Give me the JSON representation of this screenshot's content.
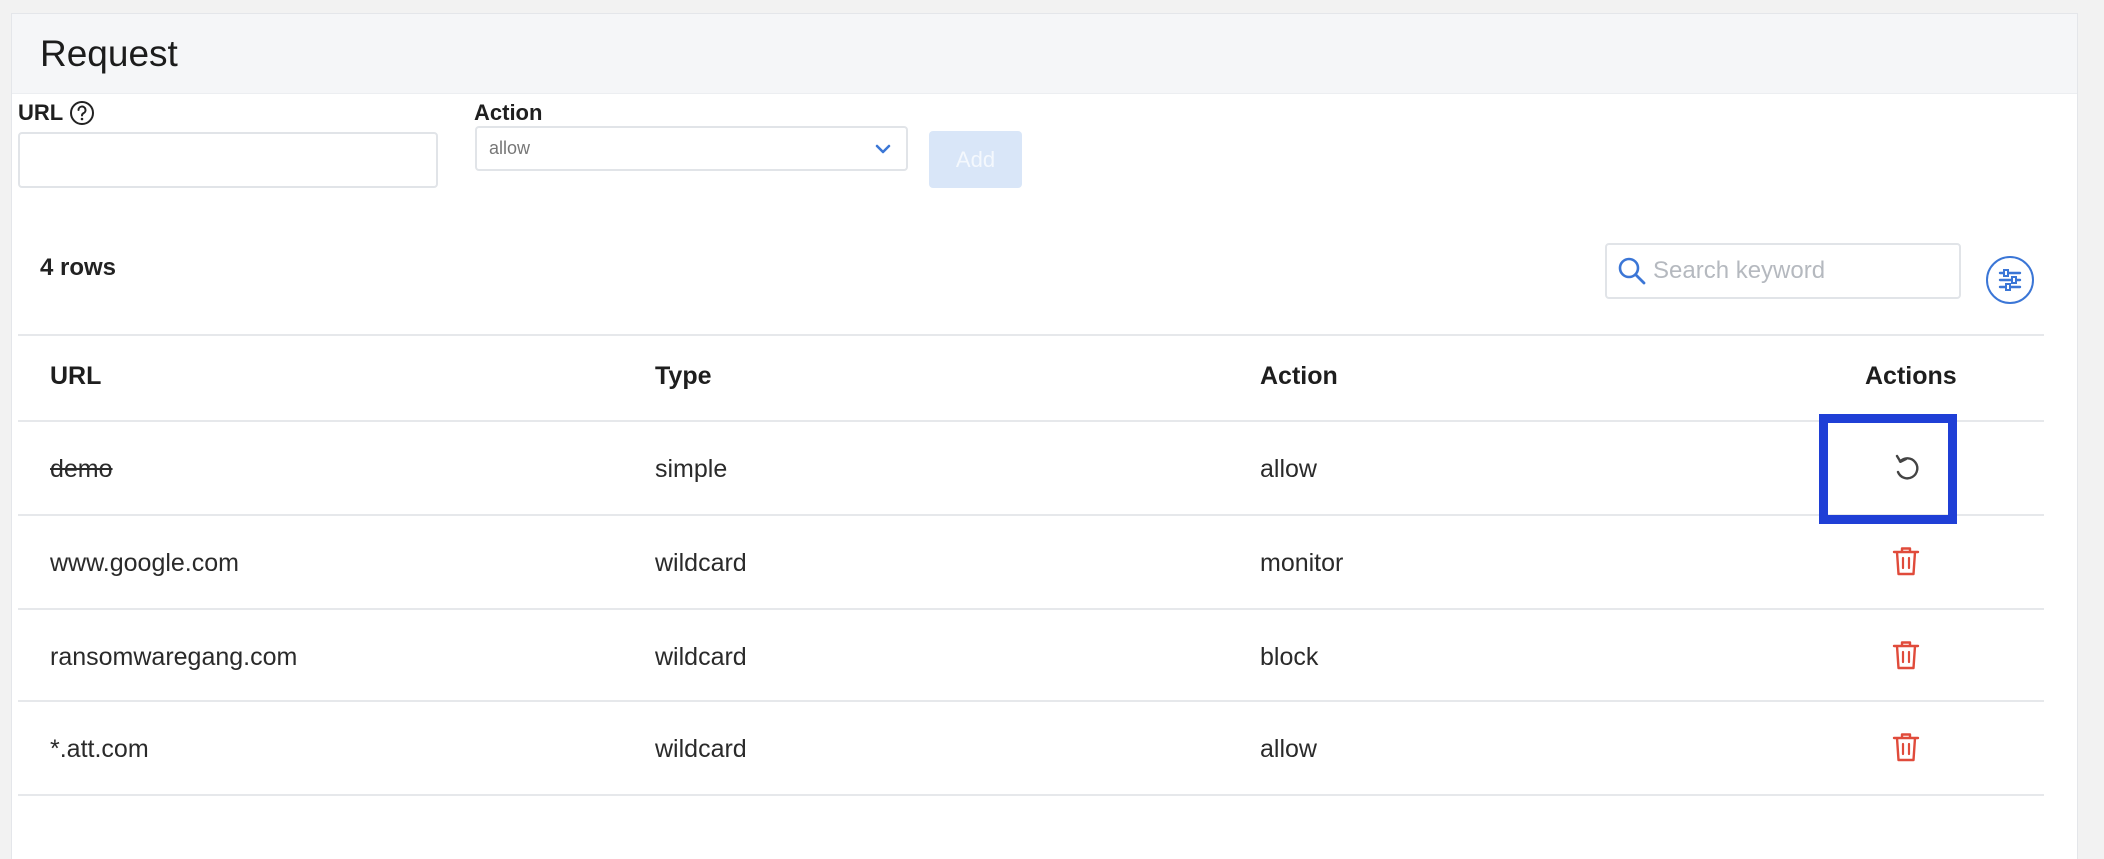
{
  "panel": {
    "title": "Request"
  },
  "form": {
    "url_label": "URL",
    "url_value": "",
    "action_label": "Action",
    "action_selected": "allow",
    "add_label": "Add"
  },
  "toolbar": {
    "rows_count": "4 rows",
    "search_placeholder": "Search keyword"
  },
  "table": {
    "headers": {
      "url": "URL",
      "type": "Type",
      "action": "Action",
      "actions": "Actions"
    },
    "rows": [
      {
        "url": "demo",
        "type": "simple",
        "action": "allow",
        "row_action_icon": "undo-icon",
        "url_struck": true
      },
      {
        "url": "www.google.com",
        "type": "wildcard",
        "action": "monitor",
        "row_action_icon": "trash-icon"
      },
      {
        "url": "ransomwaregang.com",
        "type": "wildcard",
        "action": "block",
        "row_action_icon": "trash-icon"
      },
      {
        "url": "*.att.com",
        "type": "wildcard",
        "action": "allow",
        "row_action_icon": "trash-icon"
      }
    ]
  },
  "colors": {
    "accent": "#3b76d6",
    "delete": "#e04b3b",
    "highlight": "#1f3fd6",
    "add_disabled_bg": "#d9e6f8"
  }
}
